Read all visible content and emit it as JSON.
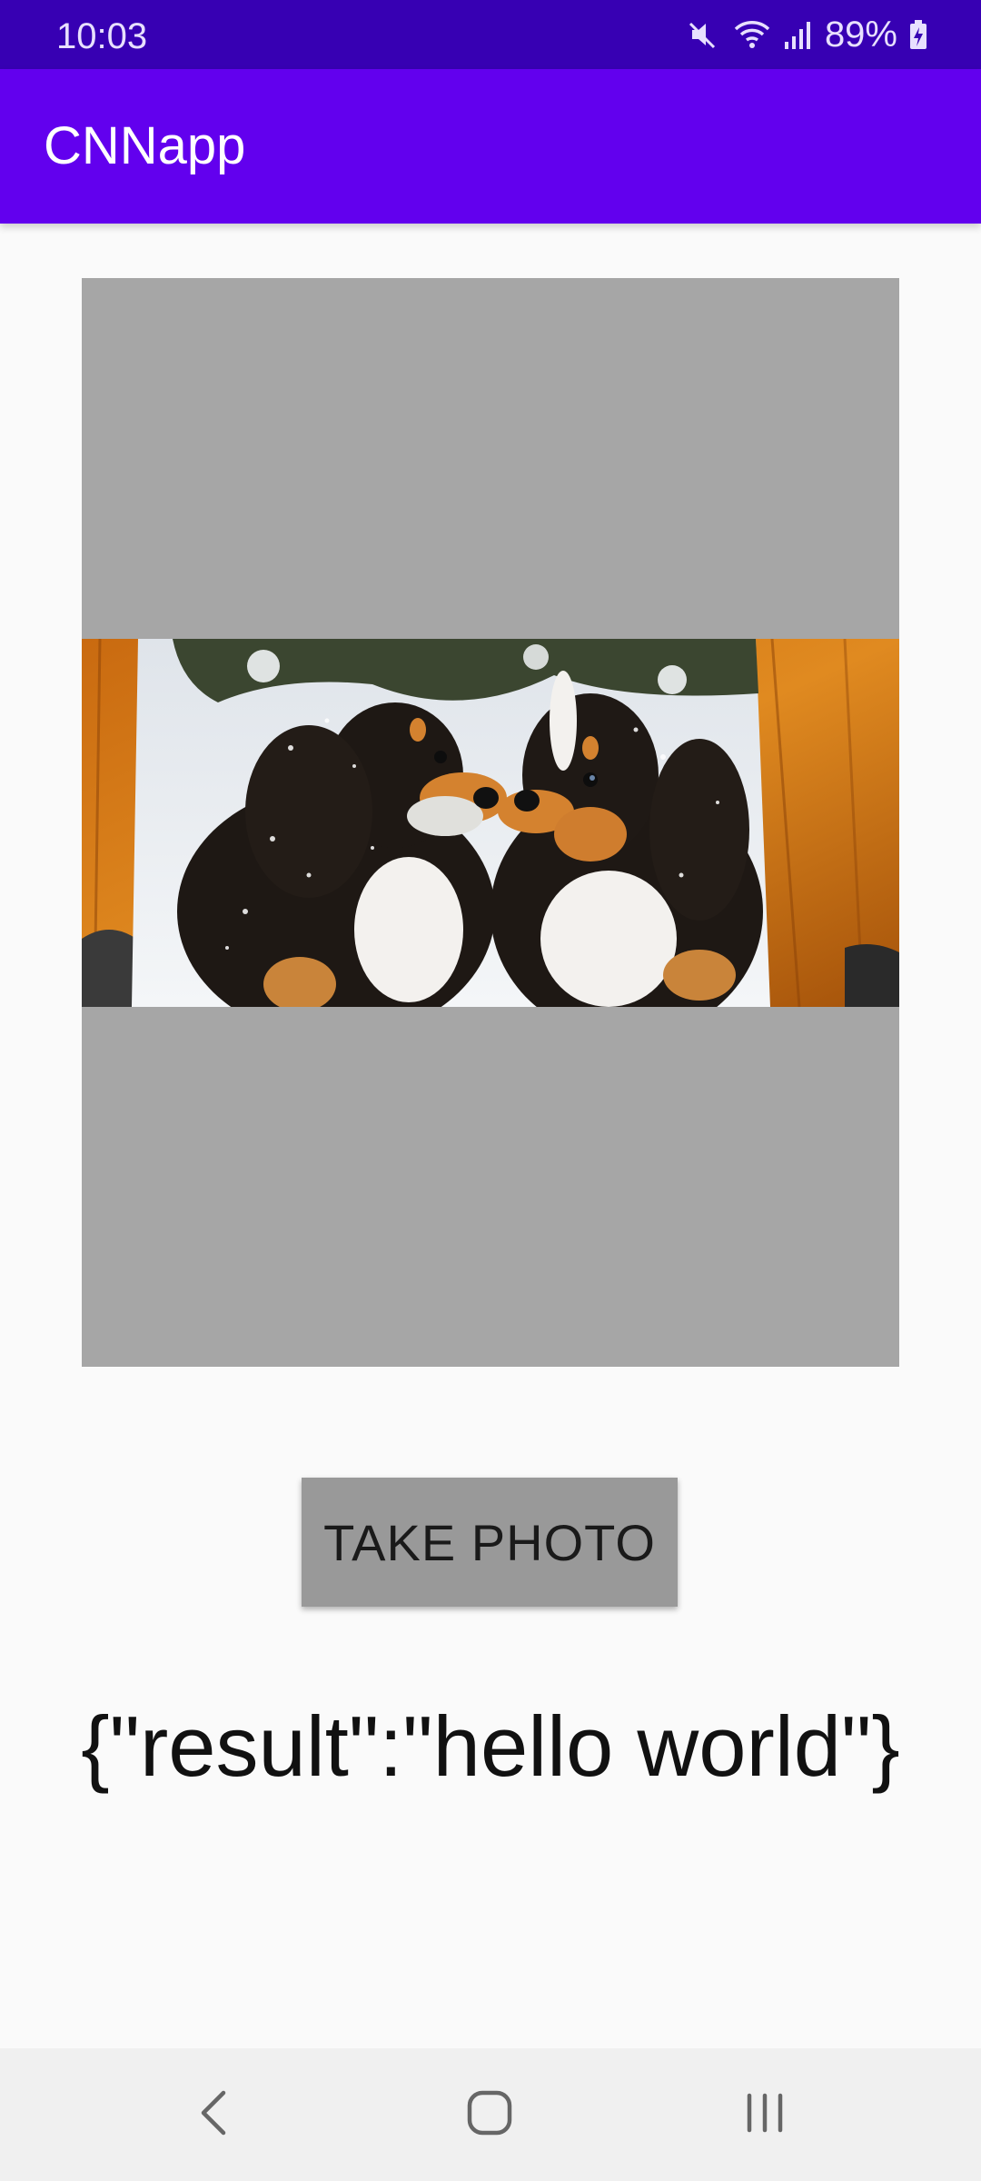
{
  "status_bar": {
    "time": "10:03",
    "battery_percent": "89%",
    "icons": [
      "mute-icon",
      "wifi-icon",
      "signal-icon",
      "battery-charging-icon"
    ]
  },
  "app_bar": {
    "title": "CNNapp"
  },
  "image_view": {
    "content": "photo of two Bernese mountain dog puppies in snow"
  },
  "actions": {
    "take_photo_label": "TAKE PHOTO"
  },
  "result": {
    "text": "{\"result\":\"hello world\"}"
  },
  "nav_bar": {
    "buttons": [
      "back-icon",
      "home-icon",
      "recents-icon"
    ]
  },
  "colors": {
    "status_bar": "#3700b3",
    "app_bar": "#6200ee",
    "image_placeholder": "#a6a6a6",
    "button": "#999999",
    "background": "#fafafa"
  }
}
